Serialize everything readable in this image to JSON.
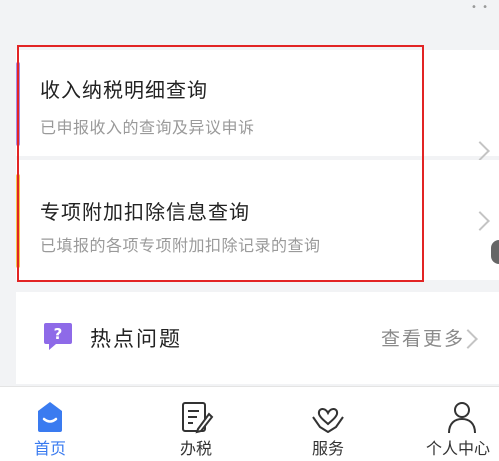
{
  "cards": [
    {
      "title": "收入纳税明细查询",
      "subtitle": "已申报收入的查询及异议申诉",
      "accent_color": "#a58be8"
    },
    {
      "title": "专项附加扣除信息查询",
      "subtitle": "已填报的各项专项附加扣除记录的查询",
      "accent_color": "#f5c74a"
    }
  ],
  "hot_questions": {
    "title": "热点问题",
    "more_label": "查看更多",
    "icon": "question-chat-icon",
    "icon_color": "#8e6ae8"
  },
  "tabbar": {
    "active_color": "#3a7bf0",
    "items": [
      {
        "label": "首页",
        "icon": "home-icon",
        "active": true
      },
      {
        "label": "办税",
        "icon": "edit-document-icon",
        "active": false
      },
      {
        "label": "服务",
        "icon": "heart-hands-icon",
        "active": false
      },
      {
        "label": "个人中心",
        "icon": "person-icon",
        "active": false
      }
    ]
  },
  "highlight_color": "#e22424"
}
